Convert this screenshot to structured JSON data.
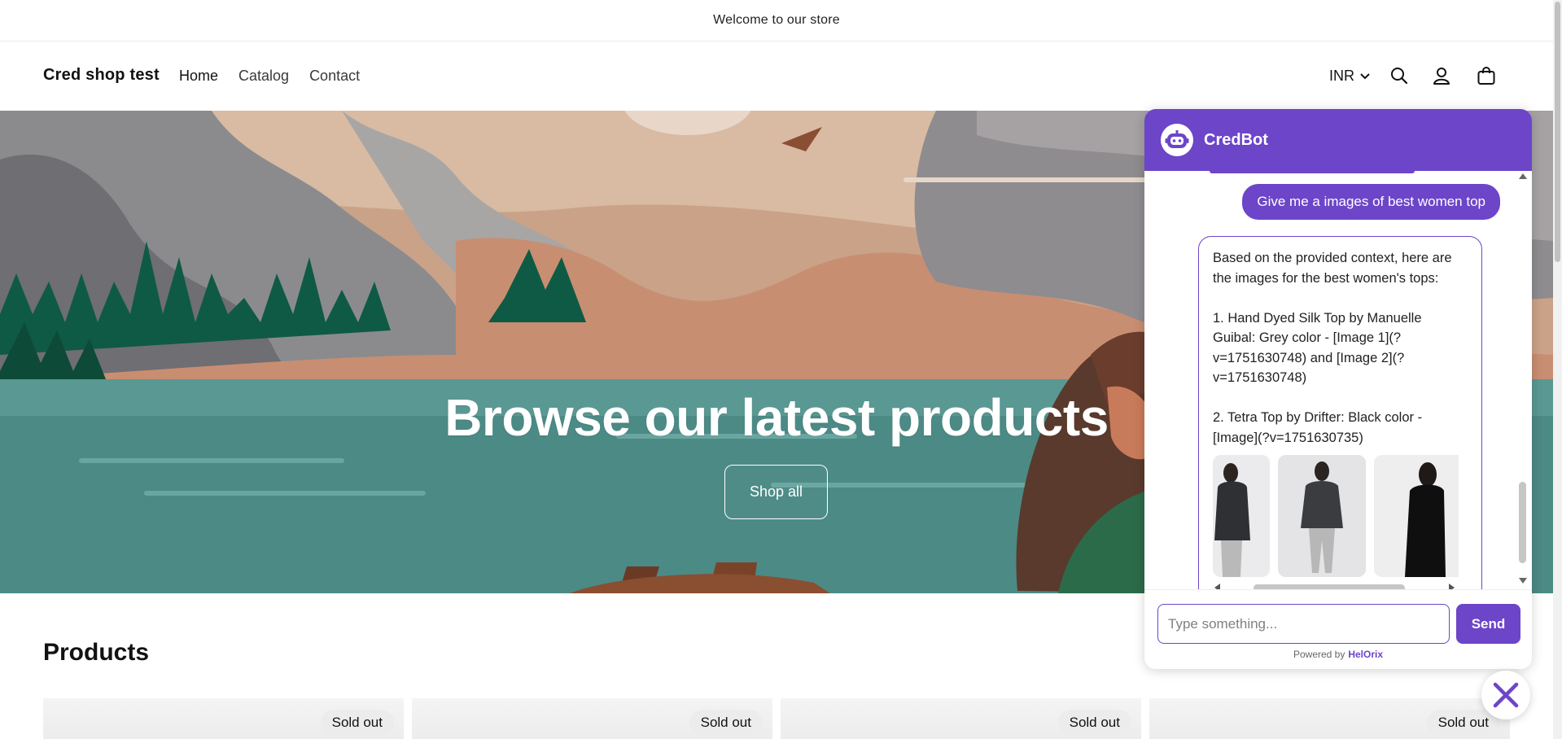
{
  "announcement": "Welcome to our store",
  "header": {
    "store_name": "Cred shop test",
    "nav": [
      "Home",
      "Catalog",
      "Contact"
    ],
    "currency": "INR",
    "icons": [
      "chevron-down-icon",
      "search-icon",
      "account-icon",
      "cart-icon"
    ]
  },
  "hero": {
    "title": "Browse our latest products",
    "button_label": "Shop all"
  },
  "products": {
    "heading": "Products",
    "cards": [
      {
        "badge": "Sold out"
      },
      {
        "badge": "Sold out"
      },
      {
        "badge": "Sold out"
      },
      {
        "badge": "Sold out"
      }
    ]
  },
  "chat": {
    "bot_name": "CredBot",
    "accent_color": "#6c45c9",
    "user_message": "Give me a images of best women top",
    "bot_message": "Based on the provided context, here are the images for the best women's tops:\n\n1. Hand Dyed Silk Top by Manuelle Guibal: Grey color - [Image 1](?v=1751630748) and [Image 2](?v=1751630748)\n\n2. Tetra Top by Drifter: Black color - [Image](?v=1751630735)",
    "input_placeholder": "Type something...",
    "send_label": "Send",
    "powered_by_label": "Powered by",
    "powered_by_brand": "HelOrix"
  }
}
